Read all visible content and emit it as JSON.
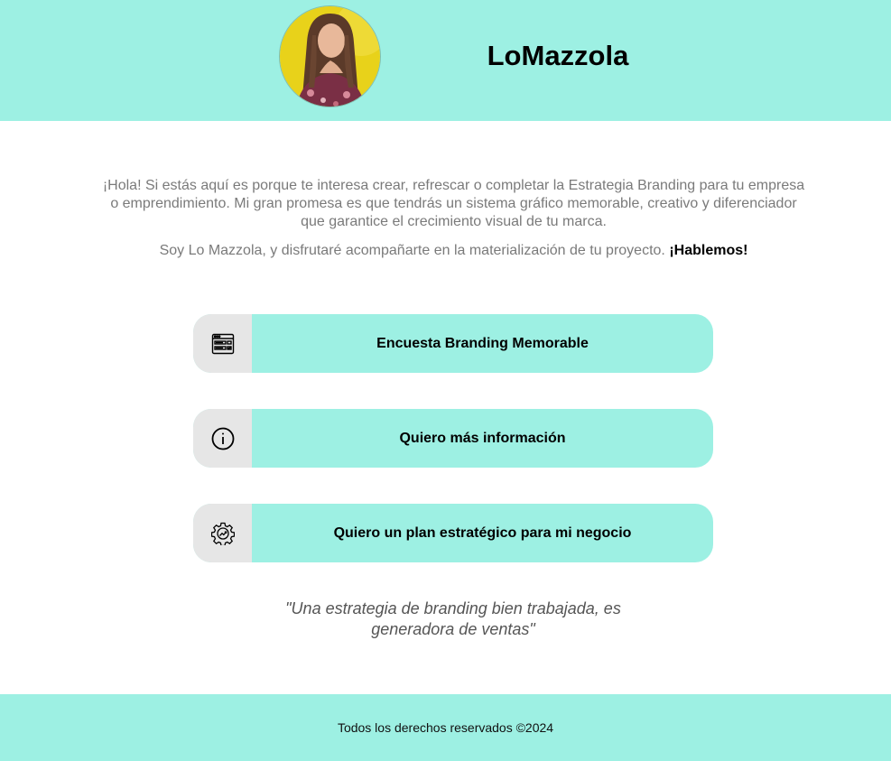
{
  "header": {
    "brand": "LoMazzola",
    "avatar_icon": "profile-photo"
  },
  "intro": {
    "paragraph1": "¡Hola! Si estás aquí es porque te interesa crear, refrescar o completar la Estrategia Branding para tu empresa o emprendimiento. Mi gran promesa es que tendrás un sistema gráfico memorable, creativo y diferenciador que garantice el crecimiento visual de tu marca.",
    "paragraph2": "Soy Lo Mazzola, y disfrutaré acompañarte en la materialización de tu proyecto.",
    "paragraph2_strong": "¡Hablemos!"
  },
  "buttons": [
    {
      "label": "Encuesta Branding Memorable",
      "icon": "browser-form-icon"
    },
    {
      "label": "Quiero más información",
      "icon": "info-icon"
    },
    {
      "label": "Quiero un plan estratégico para mi negocio",
      "icon": "gear-growth-icon"
    }
  ],
  "quote": "\"Una estrategia de branding bien trabajada, es generadora de ventas\"",
  "footer": {
    "text": "Todos los derechos reservados ©2024"
  },
  "colors": {
    "accent": "#9df0e3",
    "icon_bg": "#e6e6e6",
    "text_muted": "#7a7a7a"
  }
}
